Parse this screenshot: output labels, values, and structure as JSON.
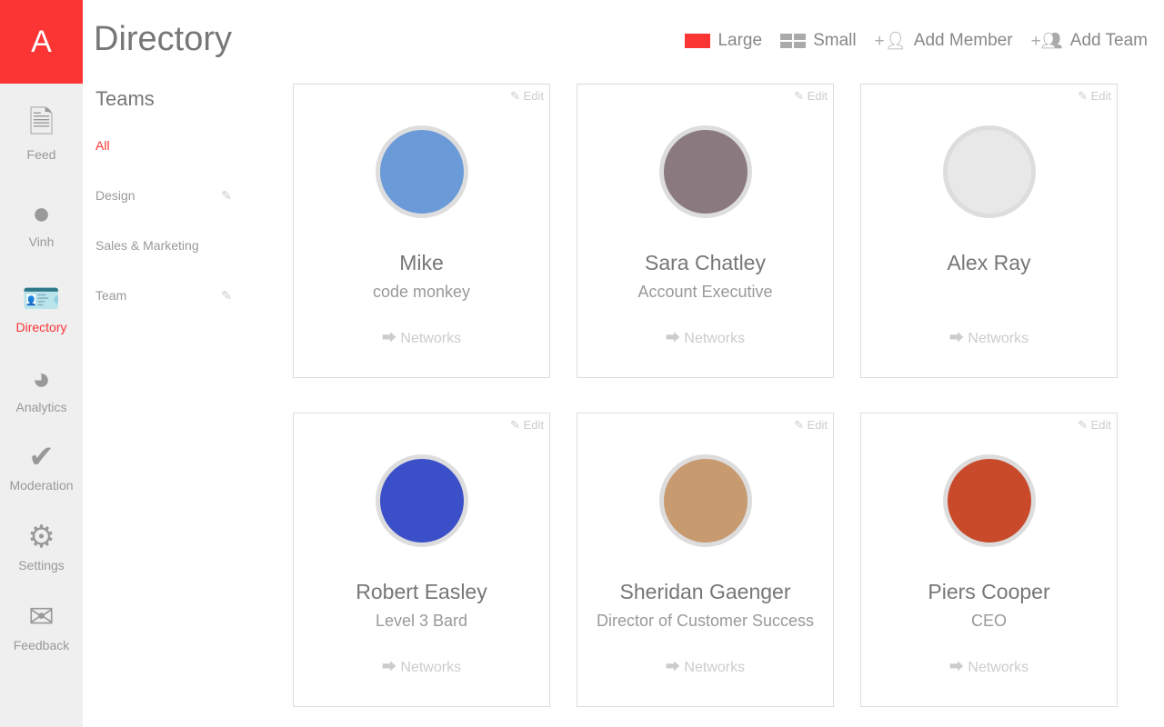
{
  "app": {
    "logo": "A",
    "title": "Directory"
  },
  "nav": [
    {
      "label": "Feed",
      "icon": "feed-icon"
    },
    {
      "label": "Vinh",
      "icon": "user-icon"
    },
    {
      "label": "Directory",
      "icon": "directory-icon",
      "active": true
    },
    {
      "label": "Analytics",
      "icon": "pie-chart-icon"
    },
    {
      "label": "Moderation",
      "icon": "check-icon"
    },
    {
      "label": "Settings",
      "icon": "gear-icon"
    },
    {
      "label": "Feedback",
      "icon": "envelope-icon"
    }
  ],
  "toolbar": {
    "large": "Large",
    "small": "Small",
    "add_member": "Add Member",
    "add_team": "Add Team"
  },
  "teams": {
    "heading": "Teams",
    "items": [
      {
        "label": "All",
        "active": true
      },
      {
        "label": "Design",
        "editable": true
      },
      {
        "label": "Sales & Marketing"
      },
      {
        "label": "Team",
        "editable": true
      }
    ]
  },
  "card_labels": {
    "edit": "Edit",
    "networks": "Networks"
  },
  "members": [
    {
      "name": "Mike",
      "role": "code monkey",
      "color": "#6a9ad8"
    },
    {
      "name": "Sara Chatley",
      "role": "Account Executive",
      "color": "#8a7a80"
    },
    {
      "name": "Alex Ray",
      "role": "",
      "color": "#e8e8e8"
    },
    {
      "name": "Robert Easley",
      "role": "Level 3 Bard",
      "color": "#3a4fc8"
    },
    {
      "name": "Sheridan Gaenger",
      "role": "Director of Customer Success",
      "color": "#c89a70"
    },
    {
      "name": "Piers Cooper",
      "role": "CEO",
      "color": "#c84a2a"
    }
  ],
  "colors": {
    "accent": "#fb3434"
  }
}
